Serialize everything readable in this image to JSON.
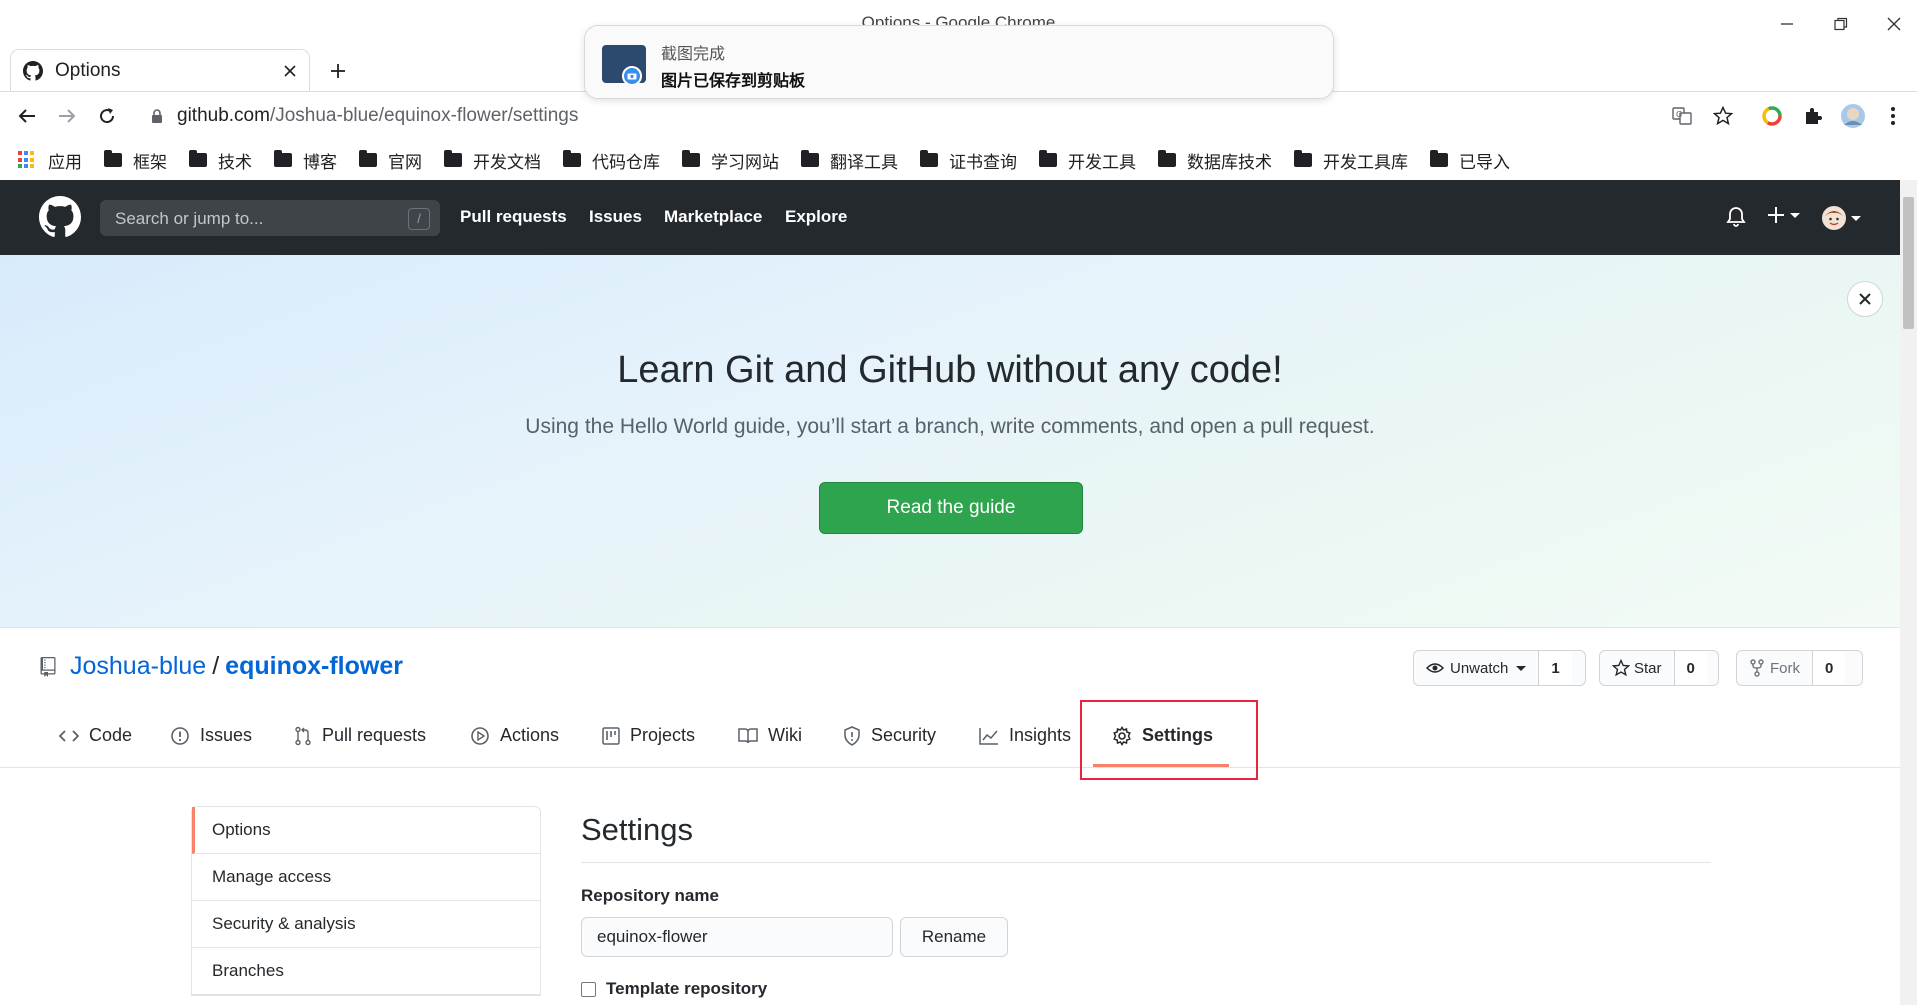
{
  "window": {
    "title": "Options - Google Chrome"
  },
  "tab": {
    "title": "Options"
  },
  "address_bar": {
    "domain": "github.com",
    "path": "/Joshua-blue/equinox-flower/settings"
  },
  "bookmarks": {
    "apps": "应用",
    "folders": [
      "框架",
      "技术",
      "博客",
      "官网",
      "开发文档",
      "代码仓库",
      "学习网站",
      "翻译工具",
      "证书查询",
      "开发工具",
      "数据库技术",
      "开发工具库",
      "已导入"
    ]
  },
  "notification": {
    "title": "截图完成",
    "message": "图片已保存到剪贴板"
  },
  "github_header": {
    "search_placeholder": "Search or jump to...",
    "slash_key": "/",
    "nav": [
      "Pull requests",
      "Issues",
      "Marketplace",
      "Explore"
    ]
  },
  "banner": {
    "title": "Learn Git and GitHub without any code!",
    "subtitle": "Using the Hello World guide, you’ll start a branch, write comments, and open a pull request.",
    "button": "Read the guide"
  },
  "repo": {
    "owner": "Joshua-blue",
    "separator": "/",
    "name": "equinox-flower",
    "watch_label": "Unwatch",
    "watch_count": "1",
    "star_label": "Star",
    "star_count": "0",
    "fork_label": "Fork",
    "fork_count": "0",
    "tabs": [
      "Code",
      "Issues",
      "Pull requests",
      "Actions",
      "Projects",
      "Wiki",
      "Security",
      "Insights",
      "Settings"
    ],
    "active_tab": "Settings"
  },
  "settings": {
    "menu": [
      "Options",
      "Manage access",
      "Security & analysis",
      "Branches"
    ],
    "active_menu": "Options",
    "heading": "Settings",
    "repo_name_label": "Repository name",
    "repo_name_value": "equinox-flower",
    "rename_button": "Rename",
    "template_label": "Template repository",
    "template_checked": false
  },
  "colors": {
    "header_bg": "#24292e",
    "link": "#0366d6",
    "primary_button": "#2ea44f",
    "active_tab_underline": "#f9826c",
    "highlight_box": "#e8253f"
  }
}
